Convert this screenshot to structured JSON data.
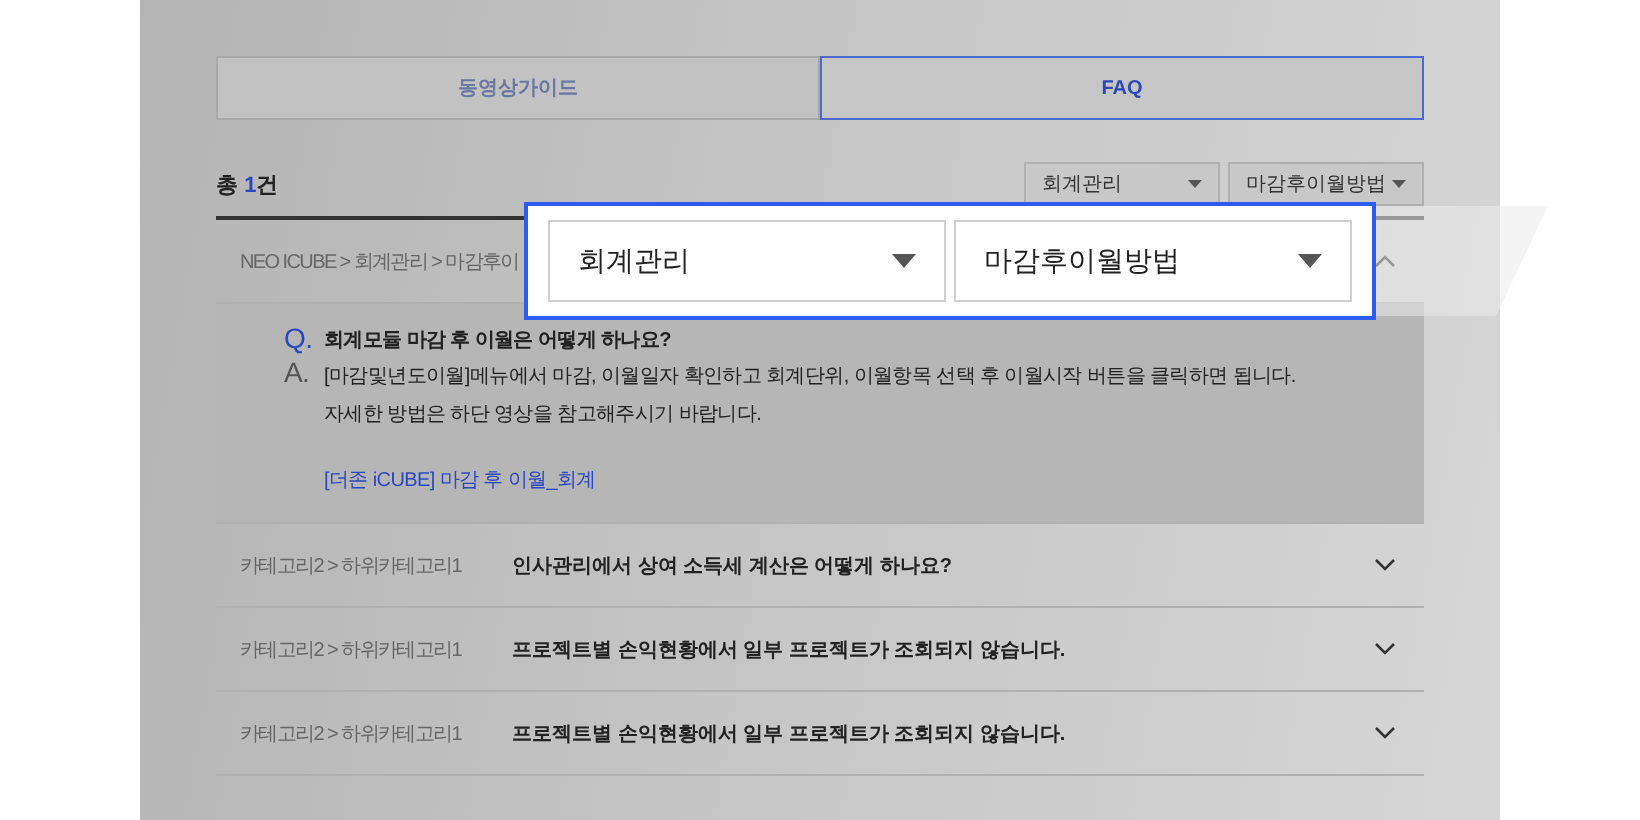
{
  "tabs": [
    {
      "label": "동영상가이드",
      "selected": false
    },
    {
      "label": "FAQ",
      "selected": true
    }
  ],
  "total": {
    "prefix": "총 ",
    "count": "1",
    "suffix": "건"
  },
  "filters": [
    {
      "value": "회계관리"
    },
    {
      "value": "마감후이월방법"
    }
  ],
  "zoom_callout": {
    "filters": [
      {
        "value": "회계관리"
      },
      {
        "value": "마감후이월방법"
      }
    ]
  },
  "faq": [
    {
      "category": "NEO ICUBE > 회계관리 > 마감후이",
      "expanded": true,
      "q_mark": "Q.",
      "question": "회계모듈 마감 후 이월은 어떻게 하나요?",
      "a_mark": "A.",
      "answer": [
        "[마감및년도이월]메뉴에서 마감, 이월일자 확인하고 회계단위, 이월항목 선택 후 이월시작 버튼을 클릭하면 됩니다.",
        "자세한 방법은 하단 영상을 참고해주시기 바랍니다."
      ],
      "link": "[더존 iCUBE] 마감 후 이월_회계"
    },
    {
      "category": "카테고리2 > 하위카테고리1",
      "expanded": false,
      "question": "인사관리에서 상여 소득세 계산은 어떻게 하나요?"
    },
    {
      "category": "카테고리2 > 하위카테고리1",
      "expanded": false,
      "question": "프로젝트별 손익현황에서 일부 프로젝트가 조회되지 않습니다."
    },
    {
      "category": "카테고리2 > 하위카테고리1",
      "expanded": false,
      "question": "프로젝트별 손익현황에서 일부 프로젝트가 조회되지 않습니다."
    }
  ]
}
